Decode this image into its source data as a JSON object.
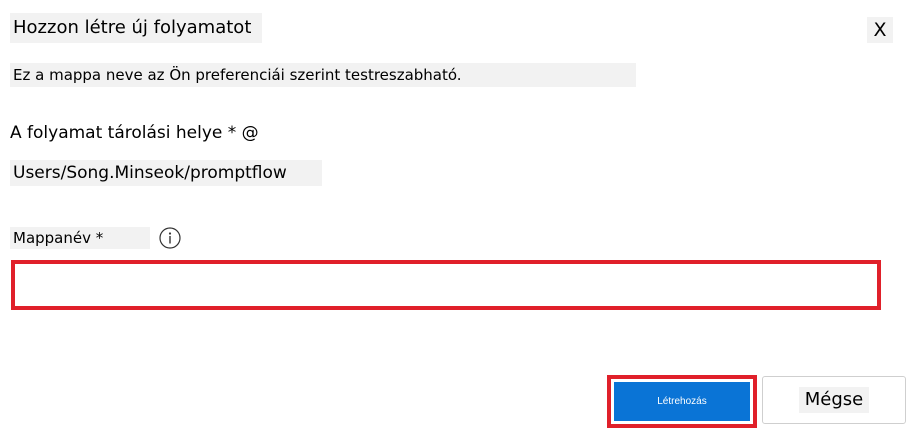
{
  "dialog": {
    "title": "Hozzon létre új folyamatot",
    "close_label": "X",
    "subtitle": "Ez a mappa neve az Ön preferenciái szerint testreszabható."
  },
  "location": {
    "label": "A folyamat tárolási helye * @",
    "value": "Users/Song.Minseok/promptflow"
  },
  "folder_name": {
    "label": "Mappanév *",
    "info_icon": "info-icon",
    "value": "",
    "placeholder": ""
  },
  "actions": {
    "create_label": "Létrehozás",
    "cancel_label": "Mégse"
  },
  "colors": {
    "primary": "#0a74d6",
    "highlight": "#e0202a",
    "label_bg": "#f2f2f2"
  }
}
